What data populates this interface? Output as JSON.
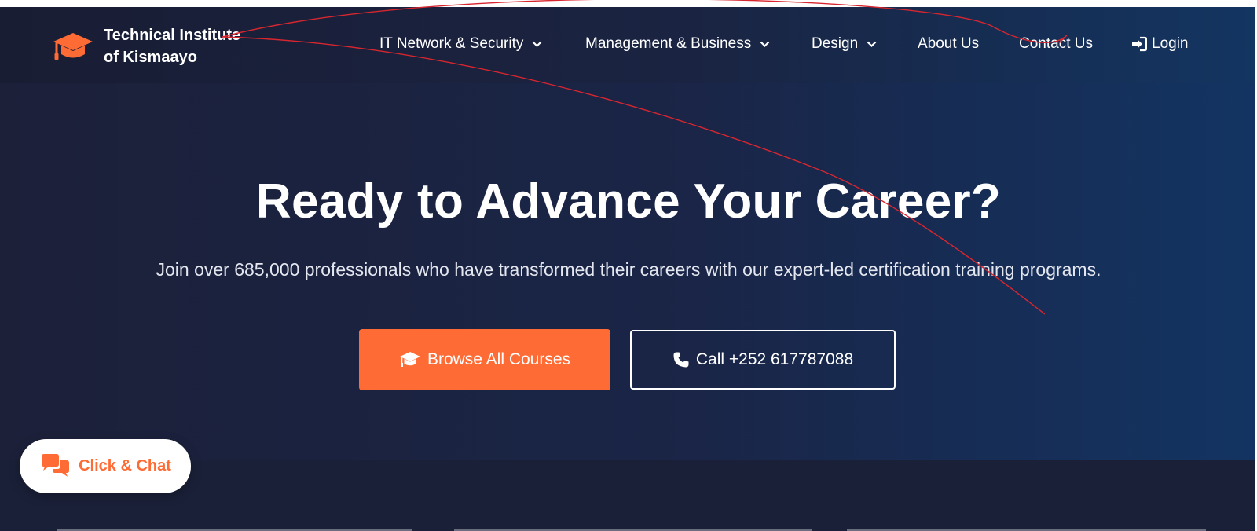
{
  "brand": {
    "name_line1": "Technical Institute",
    "name_line2": "of Kismaayo",
    "icon": "graduation-cap-icon"
  },
  "nav": {
    "items": [
      {
        "label": "IT Network & Security",
        "has_dropdown": true
      },
      {
        "label": "Management & Business",
        "has_dropdown": true
      },
      {
        "label": "Design",
        "has_dropdown": true
      },
      {
        "label": "About Us",
        "has_dropdown": false
      },
      {
        "label": "Contact Us",
        "has_dropdown": false
      }
    ],
    "login_label": "Login",
    "login_icon": "sign-in-icon"
  },
  "hero": {
    "title": "Ready to Advance Your Career?",
    "subtitle": "Join over 685,000 professionals who have transformed their careers with our expert-led certification training programs.",
    "primary_button": {
      "label": "Browse All Courses",
      "icon": "graduation-cap-icon"
    },
    "secondary_button": {
      "label": "Call +252 617787088",
      "icon": "phone-icon"
    }
  },
  "chat": {
    "label": "Click & Chat",
    "icon": "comments-icon"
  },
  "colors": {
    "accent": "#ff6b35",
    "background_dark": "#1b1f37",
    "background_blue": "#153563",
    "text": "#ffffff"
  }
}
